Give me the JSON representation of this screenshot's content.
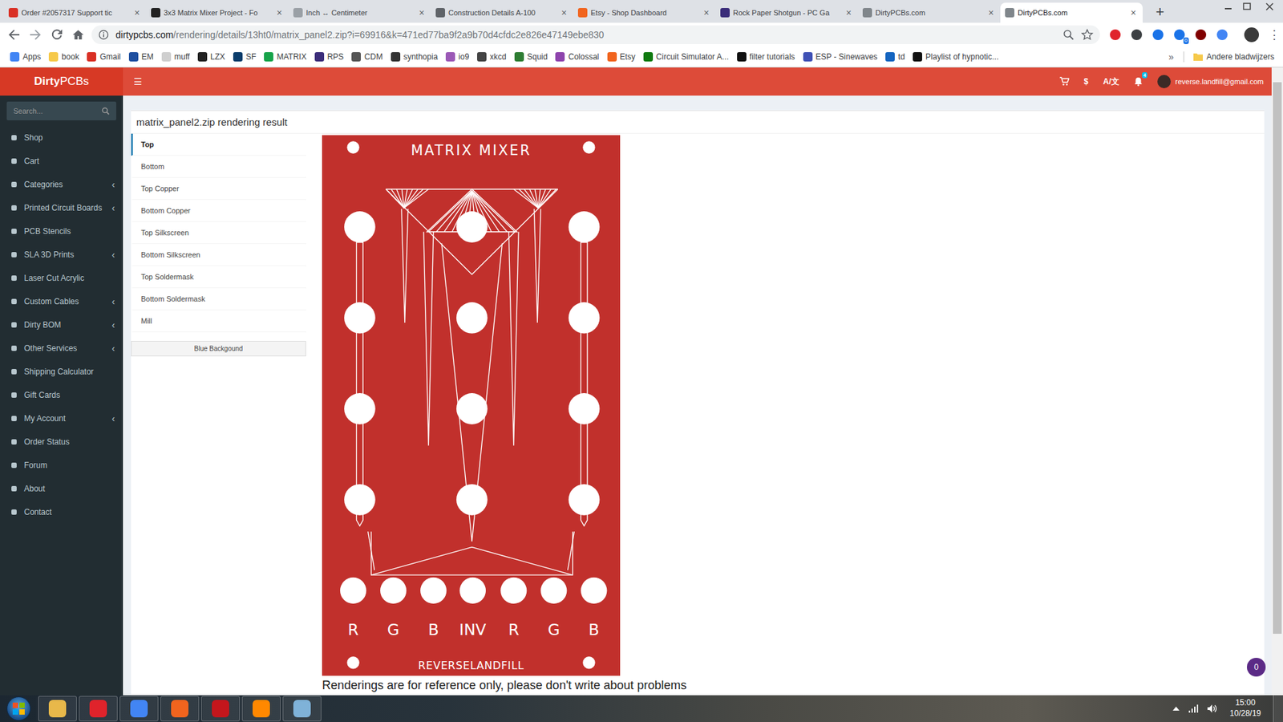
{
  "browser": {
    "tabs": [
      {
        "title": "Order #2057317 Support tic",
        "selected": false,
        "color": "#d93025"
      },
      {
        "title": "3x3 Matrix Mixer Project - Fo",
        "selected": false,
        "color": "#222222"
      },
      {
        "title": "Inch ↔ Centimeter",
        "selected": false,
        "color": "#9aa0a6"
      },
      {
        "title": "Construction Details A-100",
        "selected": false,
        "color": "#5f6368"
      },
      {
        "title": "Etsy - Shop Dashboard",
        "selected": false,
        "color": "#f1641e"
      },
      {
        "title": "Rock Paper Shotgun - PC Ga",
        "selected": false,
        "color": "#3b2d7a"
      },
      {
        "title": "DirtyPCBs.com",
        "selected": false,
        "color": "#80868b"
      },
      {
        "title": "DirtyPCBs.com",
        "selected": true,
        "color": "#80868b"
      }
    ],
    "tab_close": "×",
    "new_tab": "+",
    "url_host": "dirtypcbs.com",
    "url_rest": "/rendering/details/13ht0/matrix_panel2.zip?i=69916&k=471ed77ba9f2a9b70d4cfdc2e826e47149ebe830",
    "extensions": [
      {
        "color": "#e0232b"
      },
      {
        "color": "#3c4043"
      },
      {
        "color": "#1a73e8"
      },
      {
        "color": "#1a73e8",
        "badge": "0"
      },
      {
        "color": "#800000"
      },
      {
        "color": "#4285f4"
      }
    ],
    "menu": "⋮",
    "bookmarks": [
      {
        "label": "Apps",
        "color": "#4285f4"
      },
      {
        "label": "book",
        "color": "#f6c94a"
      },
      {
        "label": "Gmail",
        "color": "#d93025"
      },
      {
        "label": "EM",
        "color": "#1e4fa0"
      },
      {
        "label": "muff",
        "color": "#cfcfcf"
      },
      {
        "label": "LZX",
        "color": "#222222"
      },
      {
        "label": "SF",
        "color": "#0b3d6b"
      },
      {
        "label": "MATRIX",
        "color": "#17a34a"
      },
      {
        "label": "RPS",
        "color": "#3b2d7a"
      },
      {
        "label": "CDM",
        "color": "#555555"
      },
      {
        "label": "synthopia",
        "color": "#333333"
      },
      {
        "label": "io9",
        "color": "#9b59b6"
      },
      {
        "label": "xkcd",
        "color": "#444444"
      },
      {
        "label": "Squid",
        "color": "#2e7d32"
      },
      {
        "label": "Colossal",
        "color": "#8e44ad"
      },
      {
        "label": "Etsy",
        "color": "#f1641e"
      },
      {
        "label": "Circuit Simulator A...",
        "color": "#0f7a0f"
      },
      {
        "label": "filter tutorials",
        "color": "#111111"
      },
      {
        "label": "ESP - Sinewaves",
        "color": "#3f51b5"
      },
      {
        "label": "td",
        "color": "#1565c0"
      },
      {
        "label": "Playlist of hypnotic...",
        "color": "#111111"
      }
    ],
    "more": "»",
    "other_bookmarks": "Andere bladwijzers"
  },
  "site": {
    "logo_bold": "Dirty",
    "logo_rest": "PCBs",
    "menu_toggle": "☰",
    "currency": "$",
    "language": "A/文",
    "notifications": "4",
    "user": "reverse.landfill@gmail.com",
    "search_placeholder": "Search...",
    "chevron": "‹",
    "sidebar": [
      {
        "label": "Shop",
        "expandable": false
      },
      {
        "label": "Cart",
        "expandable": false
      },
      {
        "label": "Categories",
        "expandable": true
      },
      {
        "label": "Printed Circuit Boards",
        "expandable": true
      },
      {
        "label": "PCB Stencils",
        "expandable": false
      },
      {
        "label": "SLA 3D Prints",
        "expandable": true
      },
      {
        "label": "Laser Cut Acrylic",
        "expandable": false
      },
      {
        "label": "Custom Cables",
        "expandable": true
      },
      {
        "label": "Dirty BOM",
        "expandable": true
      },
      {
        "label": "Other Services",
        "expandable": true
      },
      {
        "label": "Shipping Calculator",
        "expandable": false
      },
      {
        "label": "Gift Cards",
        "expandable": false
      },
      {
        "label": "My Account",
        "expandable": true
      },
      {
        "label": "Order Status",
        "expandable": false
      },
      {
        "label": "Forum",
        "expandable": false
      },
      {
        "label": "About",
        "expandable": false
      },
      {
        "label": "Contact",
        "expandable": false
      }
    ],
    "page_title": "matrix_panel2.zip rendering result",
    "layers": [
      {
        "label": "Top",
        "selected": true
      },
      {
        "label": "Bottom",
        "selected": false
      },
      {
        "label": "Top Copper",
        "selected": false
      },
      {
        "label": "Bottom Copper",
        "selected": false
      },
      {
        "label": "Top Silkscreen",
        "selected": false
      },
      {
        "label": "Bottom Silkscreen",
        "selected": false
      },
      {
        "label": "Top Soldermask",
        "selected": false
      },
      {
        "label": "Bottom Soldermask",
        "selected": false
      },
      {
        "label": "Mill",
        "selected": false
      }
    ],
    "background_button": "Blue Backgound",
    "panel": {
      "title": "MATRIX MIXER",
      "jack_labels": [
        "R",
        "G",
        "B",
        "INV",
        "R",
        "G",
        "B"
      ],
      "brand": "REVERSELANDFILL"
    },
    "note": "Renderings are for reference only, please don't write about problems",
    "chat_count": "0"
  },
  "taskbar": {
    "apps": [
      {
        "color": "#e8b84a"
      },
      {
        "color": "#e0232b"
      },
      {
        "color": "#4285f4"
      },
      {
        "color": "#f1641e"
      },
      {
        "color": "#c4161c"
      },
      {
        "color": "#ff8800"
      },
      {
        "color": "#7fb2d8"
      }
    ],
    "time": "15:00",
    "date": "10/28/19"
  }
}
